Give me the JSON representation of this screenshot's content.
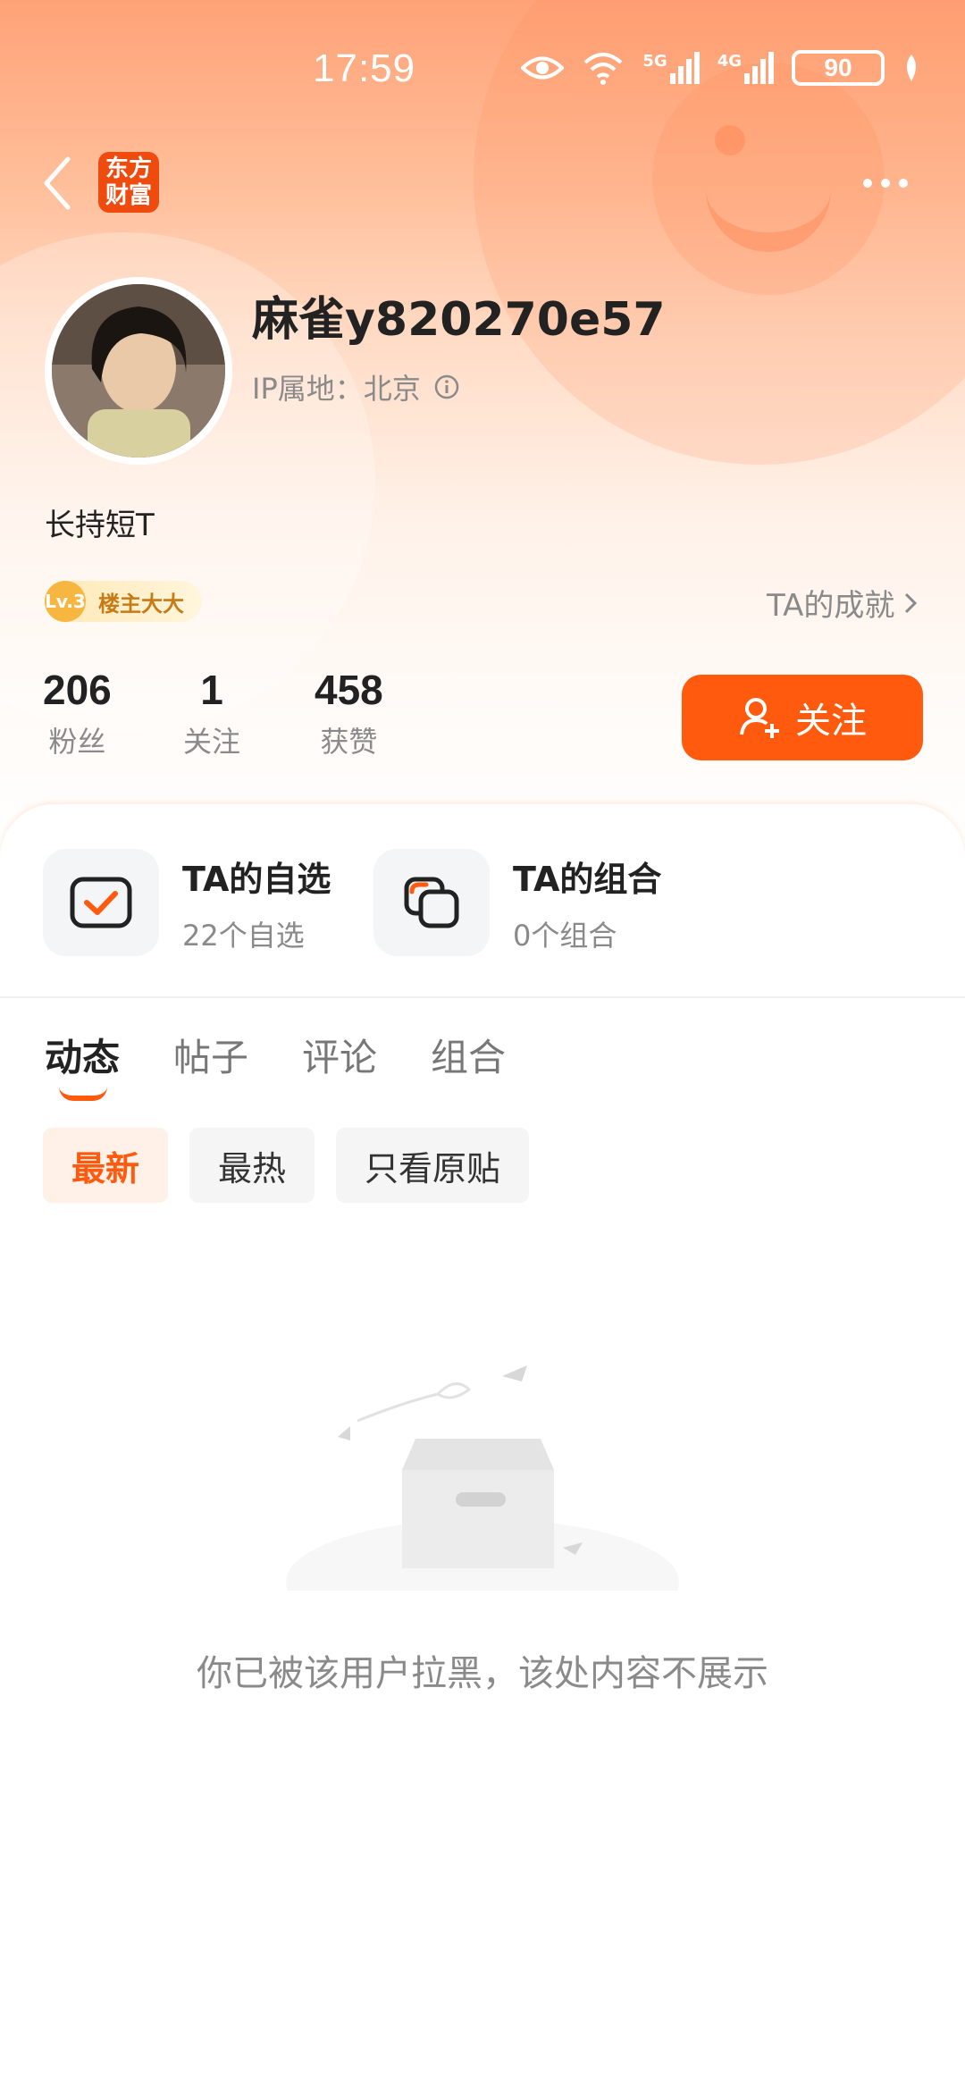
{
  "status_bar": {
    "time": "17:59",
    "battery": "90",
    "signal_1": "5G",
    "signal_2": "4G"
  },
  "nav": {
    "logo_line1": "东方",
    "logo_line2": "财富",
    "logo_color": "#f04b0f"
  },
  "profile": {
    "username": "麻雀y820270e57",
    "ip_location": "IP属地：北京",
    "bio": "长持短T",
    "badge_level": "Lv.3",
    "badge_title": "楼主大大",
    "achievements_link": "TA的成就"
  },
  "stats": [
    {
      "value": "206",
      "label": "粉丝"
    },
    {
      "value": "1",
      "label": "关注"
    },
    {
      "value": "458",
      "label": "获赞"
    }
  ],
  "follow_button": {
    "label": "关注",
    "color": "#ff5a0e"
  },
  "features": [
    {
      "title": "TA的自选",
      "subtitle": "22个自选",
      "icon": "watchlist-check-icon"
    },
    {
      "title": "TA的组合",
      "subtitle": "0个组合",
      "icon": "portfolio-icon"
    }
  ],
  "tabs": [
    {
      "label": "动态",
      "active": true
    },
    {
      "label": "帖子",
      "active": false
    },
    {
      "label": "评论",
      "active": false
    },
    {
      "label": "组合",
      "active": false
    }
  ],
  "filters": [
    {
      "label": "最新",
      "active": true
    },
    {
      "label": "最热",
      "active": false
    },
    {
      "label": "只看原贴",
      "active": false
    }
  ],
  "empty_state": {
    "message": "你已被该用户拉黑，该处内容不展示"
  }
}
